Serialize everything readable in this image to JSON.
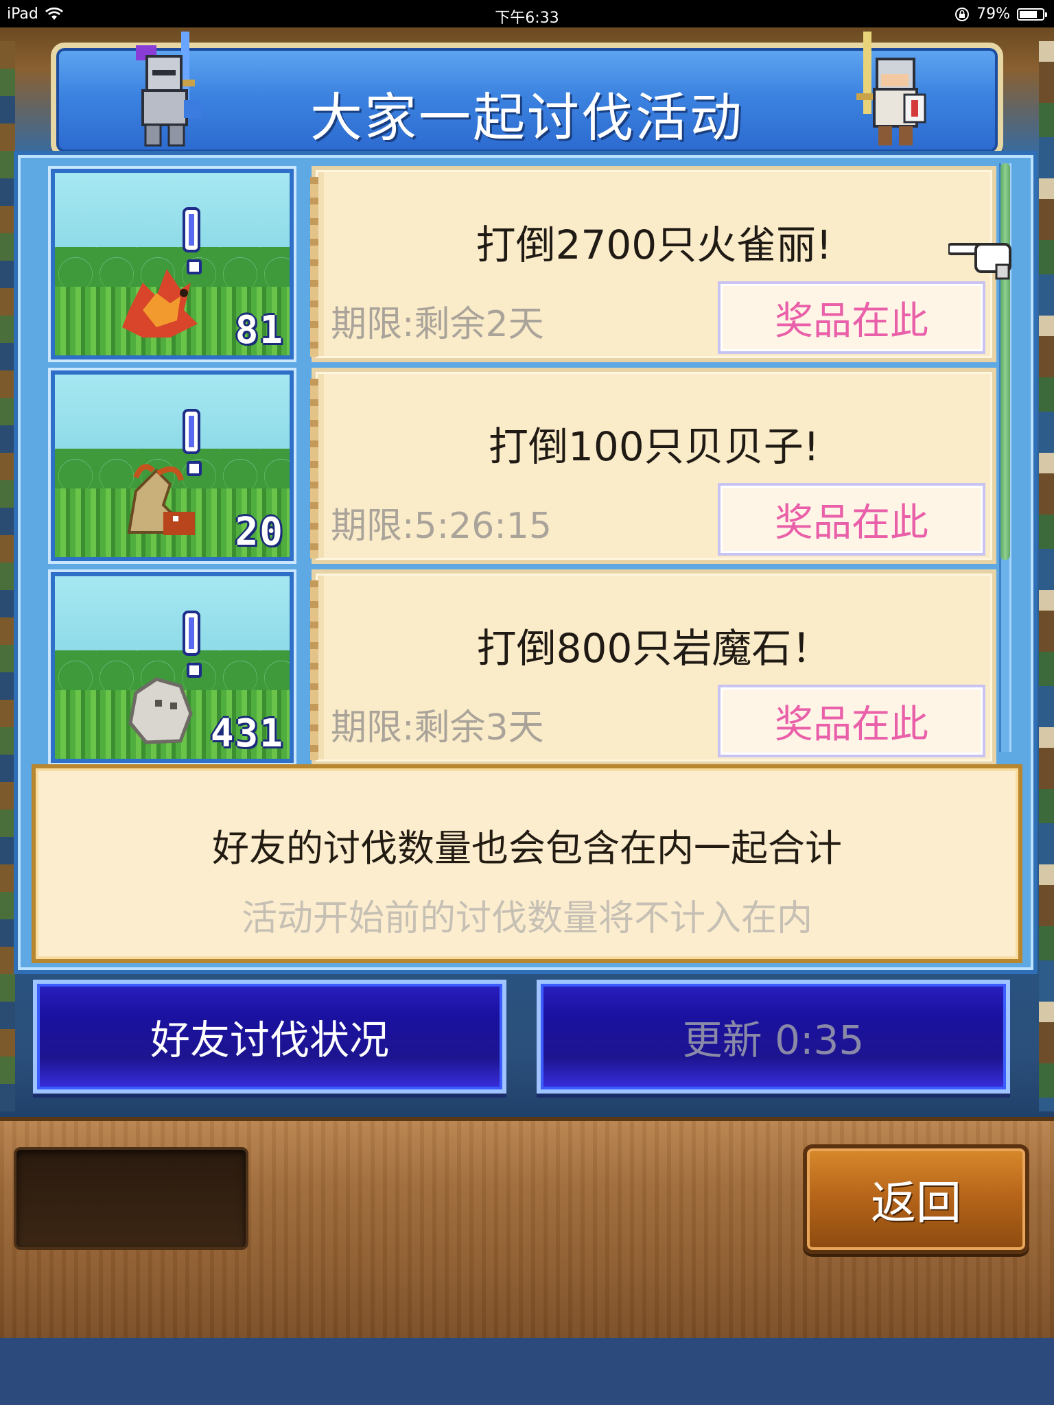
{
  "status_bar": {
    "device": "iPad",
    "time": "下午6:33",
    "battery": "79%",
    "battery_level": 0.79
  },
  "dialog": {
    "title": "大家一起讨伐活动"
  },
  "quests": [
    {
      "kill_count": "81",
      "monster": "phoenix",
      "title": "打倒2700只火雀丽!",
      "deadline": "期限:剩余2天",
      "reward_label": "奖品在此"
    },
    {
      "kill_count": "20",
      "monster": "hermit-crab",
      "title": "打倒100只贝贝子!",
      "deadline": "期限:5:26:15",
      "reward_label": "奖品在此"
    },
    {
      "kill_count": "431",
      "monster": "rock-golem",
      "title": "打倒800只岩魔石！",
      "deadline": "期限:剩余3天",
      "reward_label": "奖品在此"
    }
  ],
  "info": {
    "main": "好友的讨伐数量也会包含在内一起合计",
    "sub": "活动开始前的讨伐数量将不计入在内"
  },
  "buttons": {
    "friends_status": "好友讨伐状况",
    "refresh": "更新 0:35",
    "back": "返回"
  },
  "colors": {
    "panel_blue": "#5ea8e4",
    "reward_pink": "#ea5fa9",
    "scroll_paper": "#faebc9",
    "button_navy": "#1a11a0"
  }
}
